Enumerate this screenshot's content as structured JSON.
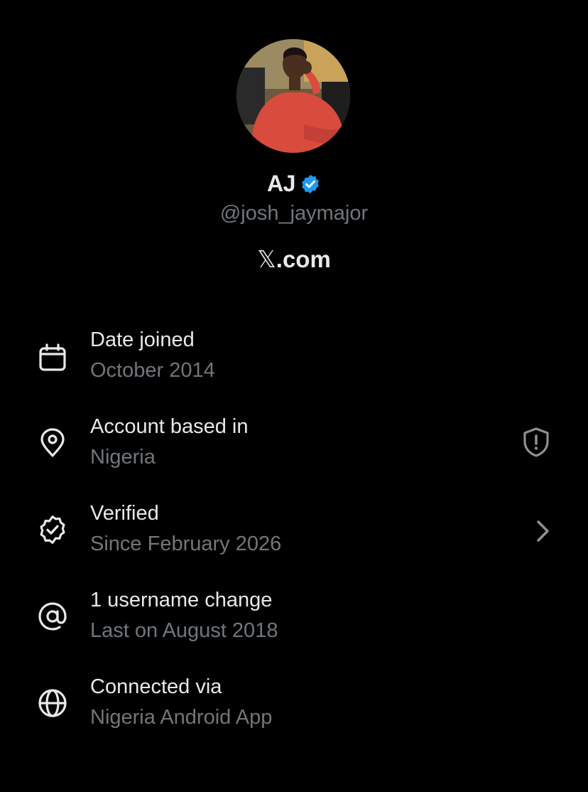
{
  "profile": {
    "display_name": "AJ",
    "handle": "@josh_jaymajor",
    "site_logo": "𝕏",
    "site_text": ".com",
    "avatar_icon": "profile-photo",
    "badge_icon": "verified-badge-icon",
    "badge_color": "#1d9bf0"
  },
  "rows": [
    {
      "title": "Date joined",
      "subtitle": "October 2014",
      "icon": "calendar-icon"
    },
    {
      "title": "Account based in",
      "subtitle": "Nigeria",
      "icon": "location-pin-icon",
      "trailing_icon": "shield-alert-icon"
    },
    {
      "title": "Verified",
      "subtitle": "Since February 2026",
      "icon": "verified-outline-icon",
      "trailing_icon": "chevron-right-icon"
    },
    {
      "title": "1 username change",
      "subtitle": "Last on August 2018",
      "icon": "at-sign-icon"
    },
    {
      "title": "Connected via",
      "subtitle": "Nigeria Android App",
      "icon": "globe-icon"
    }
  ],
  "colors": {
    "background": "#000000",
    "primary_text": "#e7e9ea",
    "secondary_text": "#71767b"
  }
}
